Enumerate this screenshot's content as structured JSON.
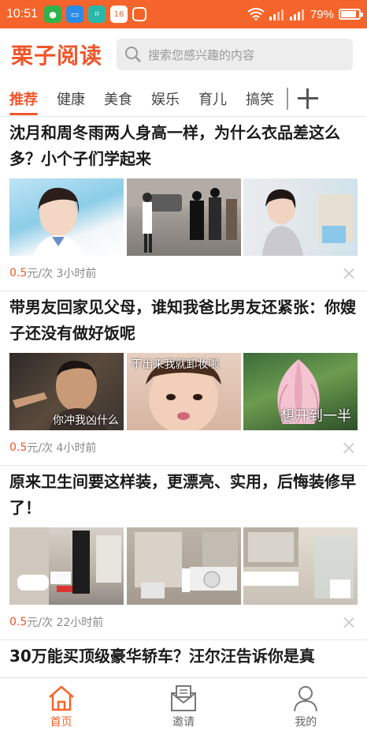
{
  "status_bar": {
    "time": "10:51",
    "battery": "79%",
    "battery_level": 0.79,
    "notification_badge": "16"
  },
  "app": {
    "logo": "栗子阅读",
    "search_placeholder": "搜索您感兴趣的内容"
  },
  "tabs": [
    {
      "label": "推荐",
      "active": true
    },
    {
      "label": "健康"
    },
    {
      "label": "美食"
    },
    {
      "label": "娱乐"
    },
    {
      "label": "育儿"
    },
    {
      "label": "搞笑"
    }
  ],
  "articles": [
    {
      "title": "沈月和周冬雨两人身高一样，为什么衣品差这么多？小个子们学起来",
      "price": "0.5",
      "unit": "元/次",
      "time": "3小时前",
      "captions": [
        "",
        "",
        ""
      ]
    },
    {
      "title": "带男友回家见父母，谁知我爸比男友还紧张：你嫂子还没有做好饭呢",
      "price": "0.5",
      "unit": "元/次",
      "time": "4小时前",
      "captions": [
        "你冲我凶什么",
        "不出来我就卸妆啦",
        "想开到一半"
      ]
    },
    {
      "title": "原来卫生间要这样装，更漂亮、实用，后悔装修早了！",
      "price": "0.5",
      "unit": "元/次",
      "time": "22小时前",
      "captions": [
        "",
        "",
        ""
      ]
    },
    {
      "title": "30万能买顶级豪华轿车？汪尔汪告诉你是真",
      "price": "",
      "unit": "",
      "time": "",
      "captions": [
        "",
        "",
        ""
      ]
    }
  ],
  "bottom_nav": [
    {
      "label": "首页",
      "icon": "home-icon",
      "active": true
    },
    {
      "label": "邀请",
      "icon": "invite-envelope-icon"
    },
    {
      "label": "我的",
      "icon": "profile-icon"
    }
  ],
  "colors": {
    "accent": "#f0552a",
    "statusbar": "#f5642a"
  }
}
